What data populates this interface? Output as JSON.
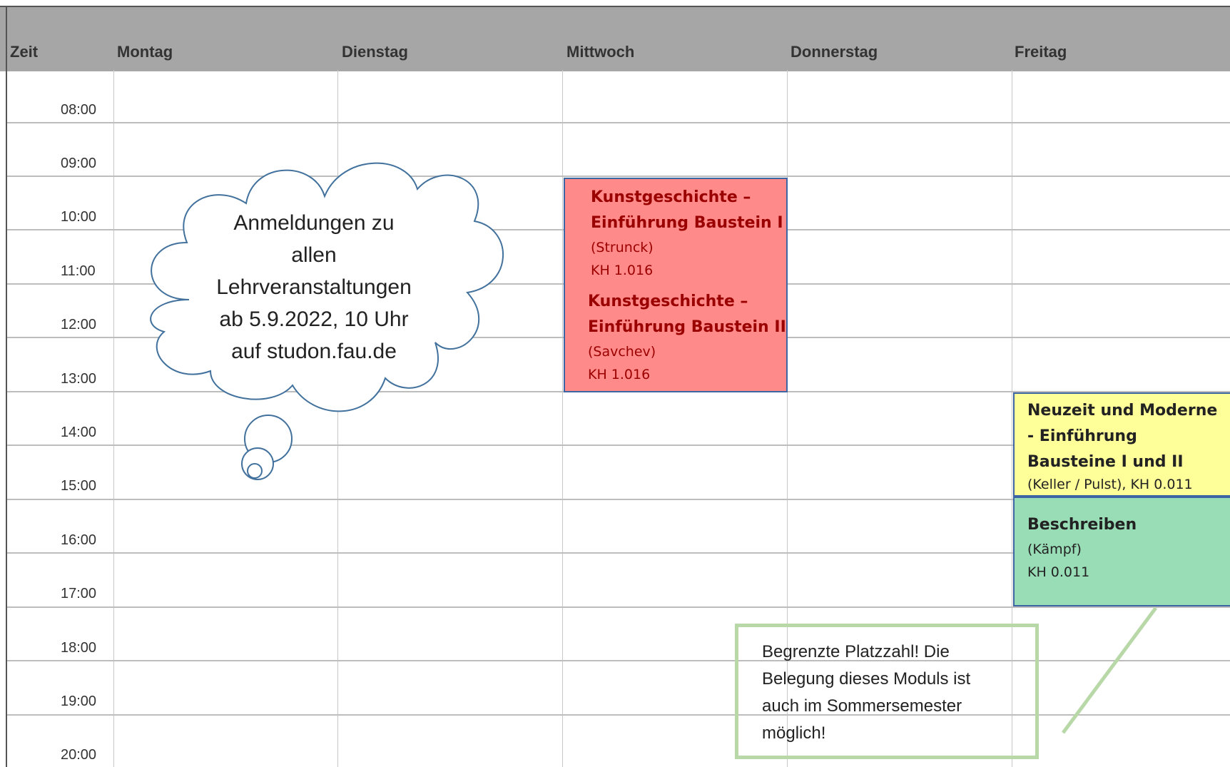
{
  "header": {
    "columns": [
      {
        "key": "zeit",
        "label": "Zeit"
      },
      {
        "key": "montag",
        "label": "Montag"
      },
      {
        "key": "dienstag",
        "label": "Dienstag"
      },
      {
        "key": "mittwoch",
        "label": "Mittwoch"
      },
      {
        "key": "donnerstag",
        "label": "Donnerstag"
      },
      {
        "key": "freitag",
        "label": "Freitag"
      }
    ]
  },
  "times": [
    "08:00",
    "09:00",
    "10:00",
    "11:00",
    "12:00",
    "13:00",
    "14:00",
    "15:00",
    "16:00",
    "17:00",
    "18:00",
    "19:00",
    "20:00"
  ],
  "events": {
    "mittwoch_1": {
      "title_line1": "Kunstgeschichte –",
      "title_line2": "Einführung Baustein I",
      "lecturer": "(Strunck)",
      "room": "KH 1.016"
    },
    "mittwoch_2": {
      "title_line1": "Kunstgeschichte –",
      "title_line2": "Einführung Baustein II",
      "lecturer": "(Savchev)",
      "room": "KH 1.016"
    },
    "freitag_1": {
      "title_line1": "Neuzeit und Moderne",
      "title_line2": "- Einführung",
      "title_line3": "Bausteine I und II",
      "meta": "(Keller / Pulst), KH 0.011"
    },
    "freitag_2": {
      "title": "Beschreiben",
      "lecturer": "(Kämpf)",
      "room": "KH 0.011"
    }
  },
  "cloud_note": {
    "lines": [
      "Anmeldungen zu",
      "allen",
      "Lehrveranstaltungen",
      "ab 5.9.2022, 10 Uhr",
      "auf studon.fau.de"
    ]
  },
  "callout_note": {
    "lines": [
      "Begrenzte Platzzahl! Die",
      "Belegung dieses Moduls ist",
      "auch im Sommersemester",
      "möglich!"
    ]
  },
  "colors": {
    "header_bg": "#a6a6a6",
    "red_event": "#ff8a8a",
    "yellow_event": "#ffff99",
    "green_event": "#99ddb6",
    "event_border": "#3d64a3",
    "cloud_stroke": "#41719c",
    "callout_stroke": "#b8d8a8"
  }
}
